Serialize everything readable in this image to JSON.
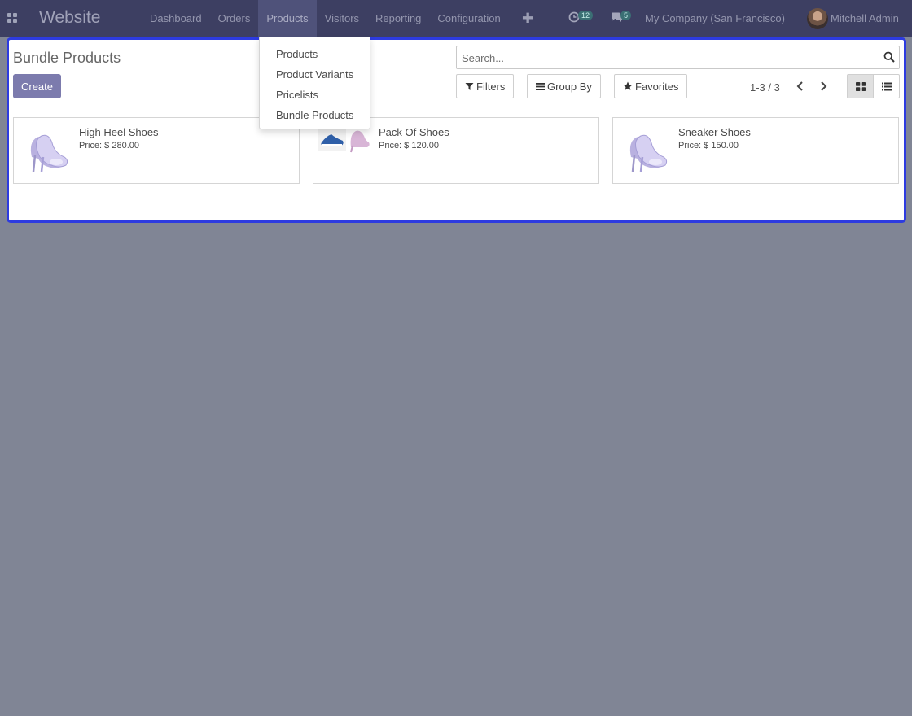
{
  "navbar": {
    "apps_icon": "apps-grid-icon",
    "brand": "Website",
    "menu": [
      {
        "label": "Dashboard",
        "active": false
      },
      {
        "label": "Orders",
        "active": false
      },
      {
        "label": "Products",
        "active": true
      },
      {
        "label": "Visitors",
        "active": false
      },
      {
        "label": "Reporting",
        "active": false
      },
      {
        "label": "Configuration",
        "active": false
      }
    ],
    "plus_icon": "plus-icon",
    "activity_count": "12",
    "messages_count": "5",
    "company": "My Company (San Francisco)",
    "user": "Mitchell Admin"
  },
  "control_panel": {
    "title": "Bundle Products",
    "create_label": "Create",
    "search_placeholder": "Search...",
    "filters_label": "Filters",
    "group_by_label": "Group By",
    "favorites_label": "Favorites",
    "pager_value": "1-3 / 3",
    "views": [
      "kanban",
      "list"
    ],
    "active_view": "kanban"
  },
  "dropdown": {
    "items": [
      "Products",
      "Product Variants",
      "Pricelists",
      "Bundle Products"
    ]
  },
  "cards": [
    {
      "name": "High Heel Shoes",
      "price": "Price: $ 280.00",
      "image": "high-heel-shoe"
    },
    {
      "name": "Pack Of Shoes",
      "price": "Price: $ 120.00",
      "image": "shoe-pack"
    },
    {
      "name": "Sneaker Shoes",
      "price": "Price: $ 150.00",
      "image": "high-heel-shoe"
    }
  ],
  "colors": {
    "navbar": "#3d3f62",
    "overlay": "#808595",
    "primary_button": "#7c7bad",
    "highlight_border": "#2d3be0",
    "badge": "#3b6f74"
  }
}
